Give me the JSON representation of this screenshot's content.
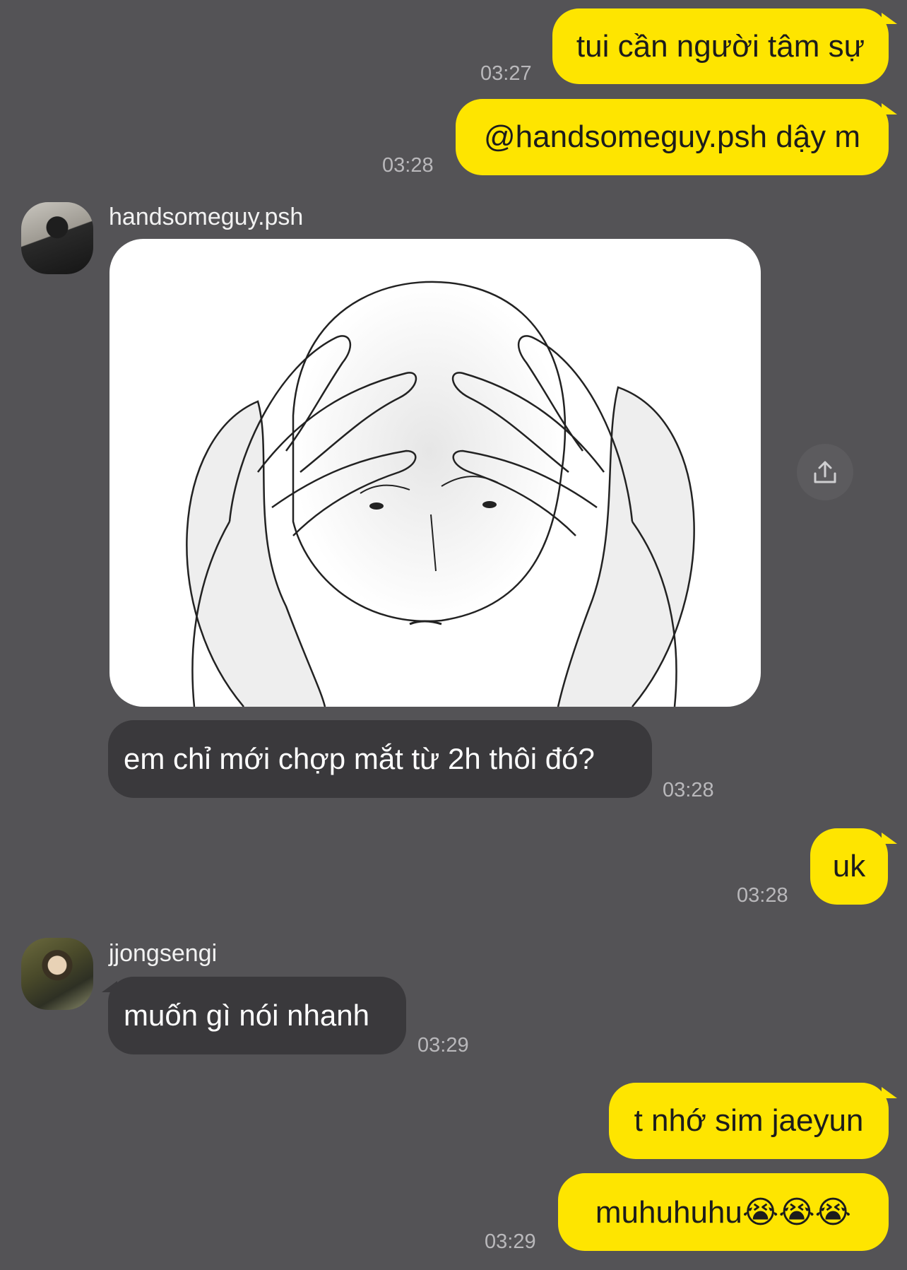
{
  "messages": [
    {
      "from": "me",
      "text": "tui cần người tâm sự",
      "time": "03:27"
    },
    {
      "from": "me",
      "text": "@handsomeguy.psh dậy m",
      "time": "03:28"
    },
    {
      "from": "them",
      "sender": "handsomeguy.psh",
      "type": "image",
      "image_desc": "sketch-stressed-man"
    },
    {
      "from": "them",
      "sender": "handsomeguy.psh",
      "text": "em chỉ mới chợp mắt từ 2h thôi đó?",
      "time": "03:28"
    },
    {
      "from": "me",
      "text": "uk",
      "time": "03:28"
    },
    {
      "from": "them",
      "sender": "jjongsengi",
      "text": "muốn gì nói nhanh",
      "time": "03:29"
    },
    {
      "from": "me",
      "text": "t nhớ sim jaeyun",
      "time": ""
    },
    {
      "from": "me",
      "text": "muhuhuhu😭😭😭",
      "time": "03:29"
    }
  ],
  "colors": {
    "background": "#545356",
    "my_bubble": "#FEE500",
    "their_bubble": "#3a393c",
    "timestamp": "#b9b8bb"
  },
  "icons": {
    "share": "share-upload-icon"
  }
}
